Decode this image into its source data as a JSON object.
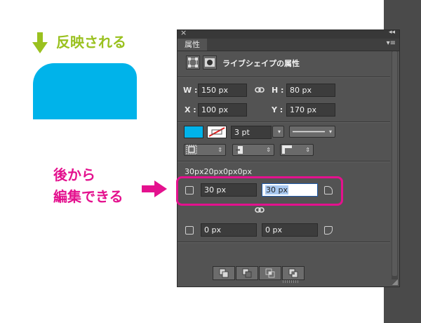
{
  "annotations": {
    "reflect_label": "反映される",
    "editable_line1": "後から",
    "editable_line2": "編集できる",
    "colors": {
      "green": "#9ac11f",
      "pink": "#e4118e",
      "shape": "#00b3ea"
    }
  },
  "panel": {
    "close_glyph": "×",
    "collapse_glyph": "◂◂",
    "tab_label": "属性",
    "menu_glyph": "▾≡",
    "title": "ライブシェイプの属性",
    "width_label": "W :",
    "width_value": "150 px",
    "height_label": "H :",
    "height_value": "80 px",
    "x_label": "X :",
    "x_value": "100 px",
    "y_label": "Y :",
    "y_value": "170 px",
    "stroke_width": "3 pt",
    "corner_summary": "30px20px0px0px",
    "corners": {
      "top_left": "30 px",
      "top_right": "30 px",
      "bottom_left": "0 px",
      "bottom_right": "0 px"
    }
  }
}
